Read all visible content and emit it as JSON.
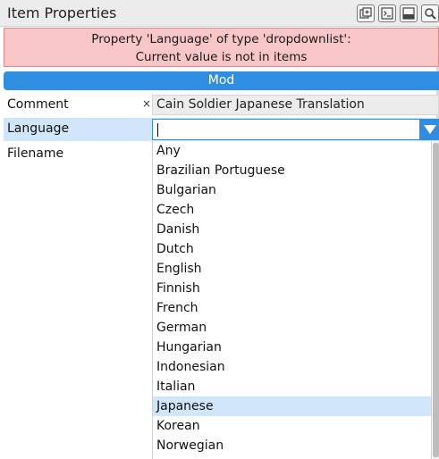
{
  "window": {
    "title": "Item Properties",
    "toolbar_icons": [
      "add-group-icon",
      "terminal-icon",
      "panel-icon",
      "search-icon"
    ]
  },
  "error": {
    "line1": "Property 'Language' of type 'dropdownlist':",
    "line2": "Current value is not in items"
  },
  "section": {
    "title": "Mod"
  },
  "fields": {
    "comment": {
      "label": "Comment",
      "clear": "×",
      "value": "Cain Soldier Japanese Translation"
    },
    "language": {
      "label": "Language",
      "value": ""
    },
    "filename": {
      "label": "Filename"
    }
  },
  "dropdown": {
    "selected": "Japanese",
    "options": [
      "Any",
      "Brazilian Portuguese",
      "Bulgarian",
      "Czech",
      "Danish",
      "Dutch",
      "English",
      "Finnish",
      "French",
      "German",
      "Hungarian",
      "Indonesian",
      "Italian",
      "Japanese",
      "Korean",
      "Norwegian"
    ]
  },
  "colors": {
    "accent": "#2f8ee0",
    "error_bg": "#f8c6c6",
    "highlight": "#cfe6fb"
  }
}
